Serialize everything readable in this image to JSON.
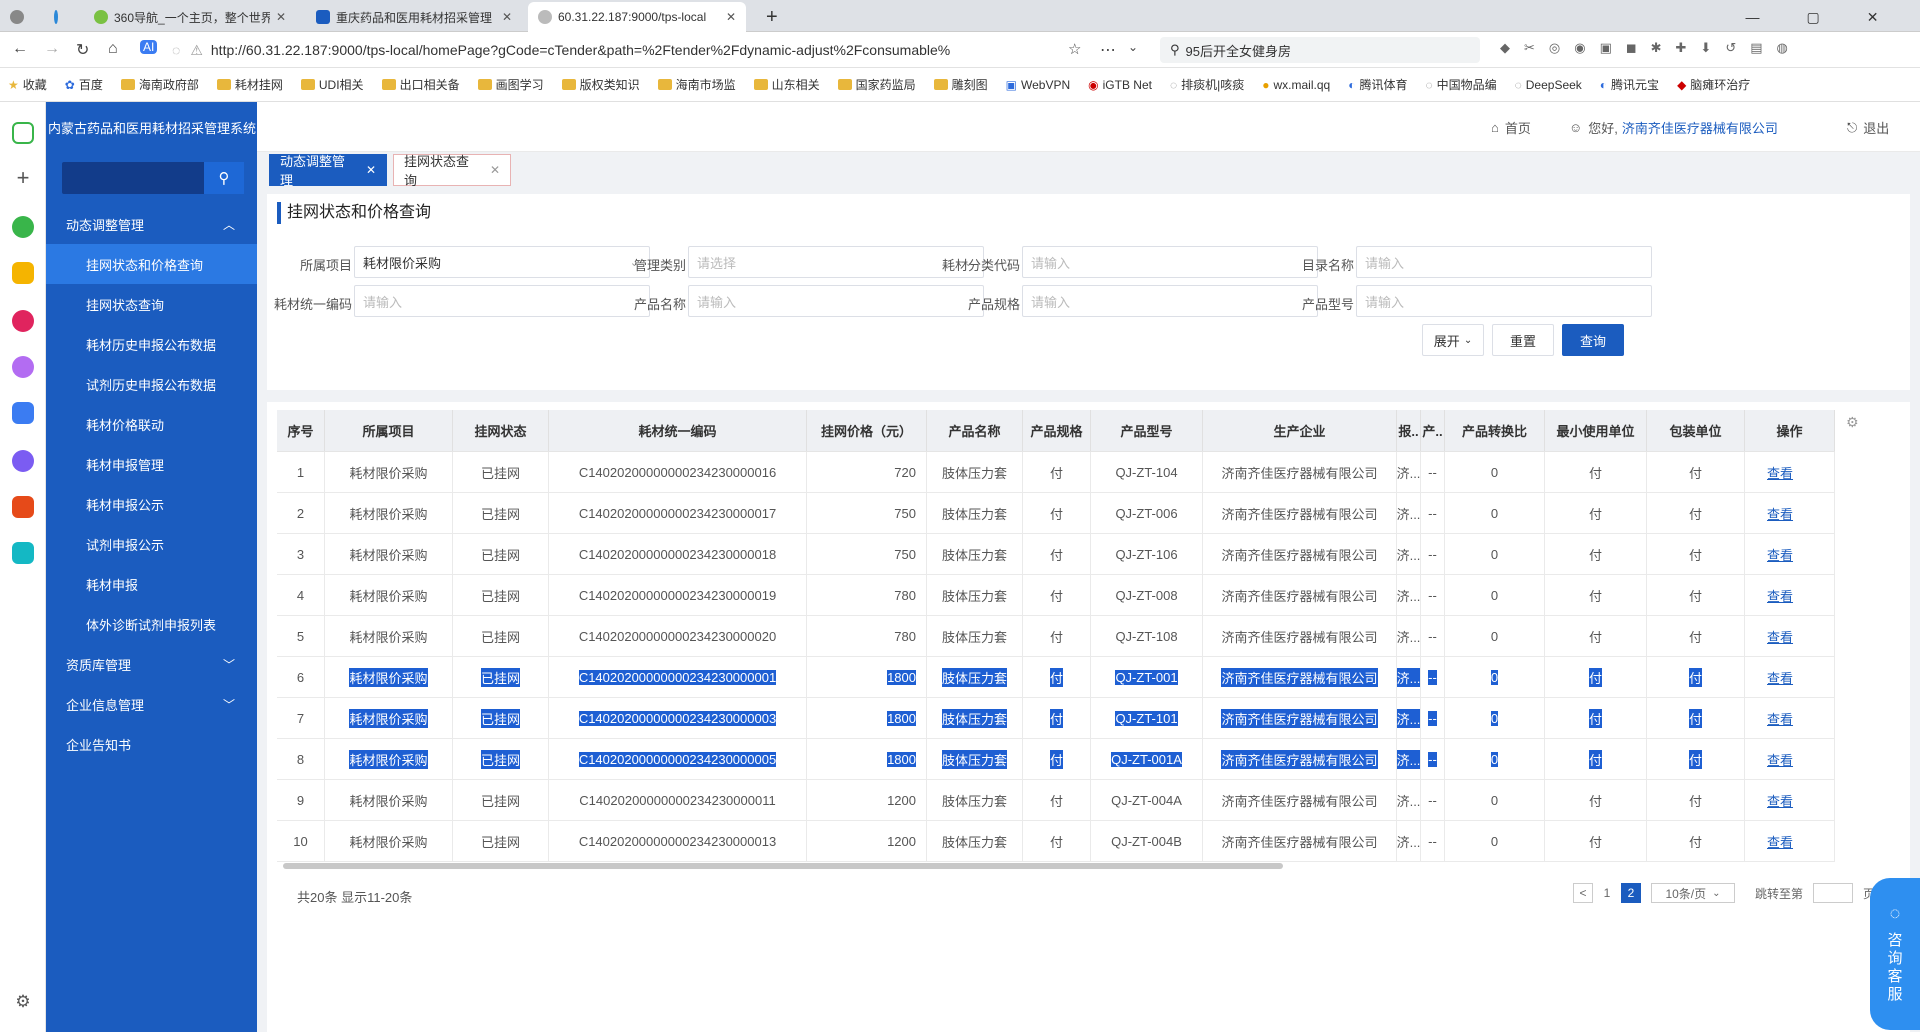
{
  "browser": {
    "tabs": [
      {
        "title": "360导航_一个主页，整个世界"
      },
      {
        "title": "重庆药品和医用耗材招采管理"
      },
      {
        "title": "60.31.22.187:9000/tps-local"
      }
    ],
    "url": "http://60.31.22.187:9000/tps-local/homePage?gCode=cTender&path=%2Ftender%2Fdynamic-adjust%2Fconsumable%",
    "search": "95后开全女健身房",
    "bookmarks": [
      "收藏",
      "百度",
      "海南政府部",
      "耗材挂网",
      "UDI相关",
      "出口相关备",
      "画图学习",
      "版权类知识",
      "海南市场监",
      "山东相关",
      "国家药监局",
      "雕刻图",
      "WebVPN",
      "iGTB Net",
      "排痰机|咳痰",
      "wx.mail.qq",
      "腾讯体育",
      "中国物品编",
      "DeepSeek",
      "腾讯元宝",
      "脑瘫环治疗"
    ]
  },
  "app": {
    "system_title": "内蒙古药品和医用耗材招采管理系统",
    "home": "首页",
    "greeting": "您好,",
    "user": "济南齐佳医疗器械有限公司",
    "logout": "退出"
  },
  "sidebar": {
    "group_main": "动态调整管理",
    "items": [
      "挂网状态和价格查询",
      "挂网状态查询",
      "耗材历史申报公布数据",
      "试剂历史申报公布数据",
      "耗材价格联动",
      "耗材申报管理",
      "耗材申报公示",
      "试剂申报公示",
      "耗材申报",
      "体外诊断试剂申报列表"
    ],
    "groups": [
      "资质库管理",
      "企业信息管理",
      "企业告知书"
    ]
  },
  "page_tabs": [
    "动态调整管理",
    "挂网状态查询"
  ],
  "panel_title": "挂网状态和价格查询",
  "filters": {
    "project_label": "所属项目",
    "project_value": "耗材限价采购",
    "category_label": "管理类别",
    "category_placeholder": "请选择",
    "code_label": "耗材分类代码",
    "code_placeholder": "请输入",
    "catalog_label": "目录名称",
    "catalog_placeholder": "请输入",
    "unicode_label": "耗材统一编码",
    "unicode_placeholder": "请输入",
    "prodname_label": "产品名称",
    "prodname_placeholder": "请输入",
    "spec_label": "产品规格",
    "spec_placeholder": "请输入",
    "model_label": "产品型号",
    "model_placeholder": "请输入",
    "expand": "展开",
    "reset": "重置",
    "query": "查询"
  },
  "table": {
    "headers": [
      "序号",
      "所属项目",
      "挂网状态",
      "耗材统一编码",
      "挂网价格（元）",
      "产品名称",
      "产品规格",
      "产品型号",
      "生产企业",
      "报..",
      "产..",
      "产品转换比",
      "最小使用单位",
      "包装单位",
      "操作"
    ],
    "rows": [
      {
        "no": "1",
        "proj": "耗材限价采购",
        "status": "已挂网",
        "code": "C14020200000000234230000016",
        "price": "720",
        "name": "肢体压力套",
        "spec": "付",
        "model": "QJ-ZT-104",
        "maker": "济南齐佳医疗器械有限公司",
        "bao": "济...",
        "chan": "--",
        "ratio": "0",
        "minunit": "付",
        "pack": "付",
        "op": "查看",
        "hl": false
      },
      {
        "no": "2",
        "proj": "耗材限价采购",
        "status": "已挂网",
        "code": "C14020200000000234230000017",
        "price": "750",
        "name": "肢体压力套",
        "spec": "付",
        "model": "QJ-ZT-006",
        "maker": "济南齐佳医疗器械有限公司",
        "bao": "济...",
        "chan": "--",
        "ratio": "0",
        "minunit": "付",
        "pack": "付",
        "op": "查看",
        "hl": false
      },
      {
        "no": "3",
        "proj": "耗材限价采购",
        "status": "已挂网",
        "code": "C14020200000000234230000018",
        "price": "750",
        "name": "肢体压力套",
        "spec": "付",
        "model": "QJ-ZT-106",
        "maker": "济南齐佳医疗器械有限公司",
        "bao": "济...",
        "chan": "--",
        "ratio": "0",
        "minunit": "付",
        "pack": "付",
        "op": "查看",
        "hl": false
      },
      {
        "no": "4",
        "proj": "耗材限价采购",
        "status": "已挂网",
        "code": "C14020200000000234230000019",
        "price": "780",
        "name": "肢体压力套",
        "spec": "付",
        "model": "QJ-ZT-008",
        "maker": "济南齐佳医疗器械有限公司",
        "bao": "济...",
        "chan": "--",
        "ratio": "0",
        "minunit": "付",
        "pack": "付",
        "op": "查看",
        "hl": false
      },
      {
        "no": "5",
        "proj": "耗材限价采购",
        "status": "已挂网",
        "code": "C14020200000000234230000020",
        "price": "780",
        "name": "肢体压力套",
        "spec": "付",
        "model": "QJ-ZT-108",
        "maker": "济南齐佳医疗器械有限公司",
        "bao": "济...",
        "chan": "--",
        "ratio": "0",
        "minunit": "付",
        "pack": "付",
        "op": "查看",
        "hl": false
      },
      {
        "no": "6",
        "proj": "耗材限价采购",
        "status": "已挂网",
        "code": "C14020200000000234230000001",
        "price": "1800",
        "name": "肢体压力套",
        "spec": "付",
        "model": "QJ-ZT-001",
        "maker": "济南齐佳医疗器械有限公司",
        "bao": "济...",
        "chan": "--",
        "ratio": "0",
        "minunit": "付",
        "pack": "付",
        "op": "查看",
        "hl": true
      },
      {
        "no": "7",
        "proj": "耗材限价采购",
        "status": "已挂网",
        "code": "C14020200000000234230000003",
        "price": "1800",
        "name": "肢体压力套",
        "spec": "付",
        "model": "QJ-ZT-101",
        "maker": "济南齐佳医疗器械有限公司",
        "bao": "济...",
        "chan": "--",
        "ratio": "0",
        "minunit": "付",
        "pack": "付",
        "op": "查看",
        "hl": true
      },
      {
        "no": "8",
        "proj": "耗材限价采购",
        "status": "已挂网",
        "code": "C14020200000000234230000005",
        "price": "1800",
        "name": "肢体压力套",
        "spec": "付",
        "model": "QJ-ZT-001A",
        "maker": "济南齐佳医疗器械有限公司",
        "bao": "济...",
        "chan": "--",
        "ratio": "0",
        "minunit": "付",
        "pack": "付",
        "op": "查看",
        "hl": true
      },
      {
        "no": "9",
        "proj": "耗材限价采购",
        "status": "已挂网",
        "code": "C14020200000000234230000011",
        "price": "1200",
        "name": "肢体压力套",
        "spec": "付",
        "model": "QJ-ZT-004A",
        "maker": "济南齐佳医疗器械有限公司",
        "bao": "济...",
        "chan": "--",
        "ratio": "0",
        "minunit": "付",
        "pack": "付",
        "op": "查看",
        "hl": false
      },
      {
        "no": "10",
        "proj": "耗材限价采购",
        "status": "已挂网",
        "code": "C14020200000000234230000013",
        "price": "1200",
        "name": "肢体压力套",
        "spec": "付",
        "model": "QJ-ZT-004B",
        "maker": "济南齐佳医疗器械有限公司",
        "bao": "济...",
        "chan": "--",
        "ratio": "0",
        "minunit": "付",
        "pack": "付",
        "op": "查看",
        "hl": false
      }
    ]
  },
  "pagination": {
    "summary": "共20条 显示11-20条",
    "prev": "<",
    "page1": "1",
    "page2": "2",
    "page_size": "10条/页",
    "goto": "跳转至第",
    "page_suffix": "页"
  },
  "consult": [
    "咨",
    "询",
    "客",
    "服"
  ],
  "colors": {
    "brand": "#1b5cbf",
    "highlight": "#1e5fd3"
  }
}
